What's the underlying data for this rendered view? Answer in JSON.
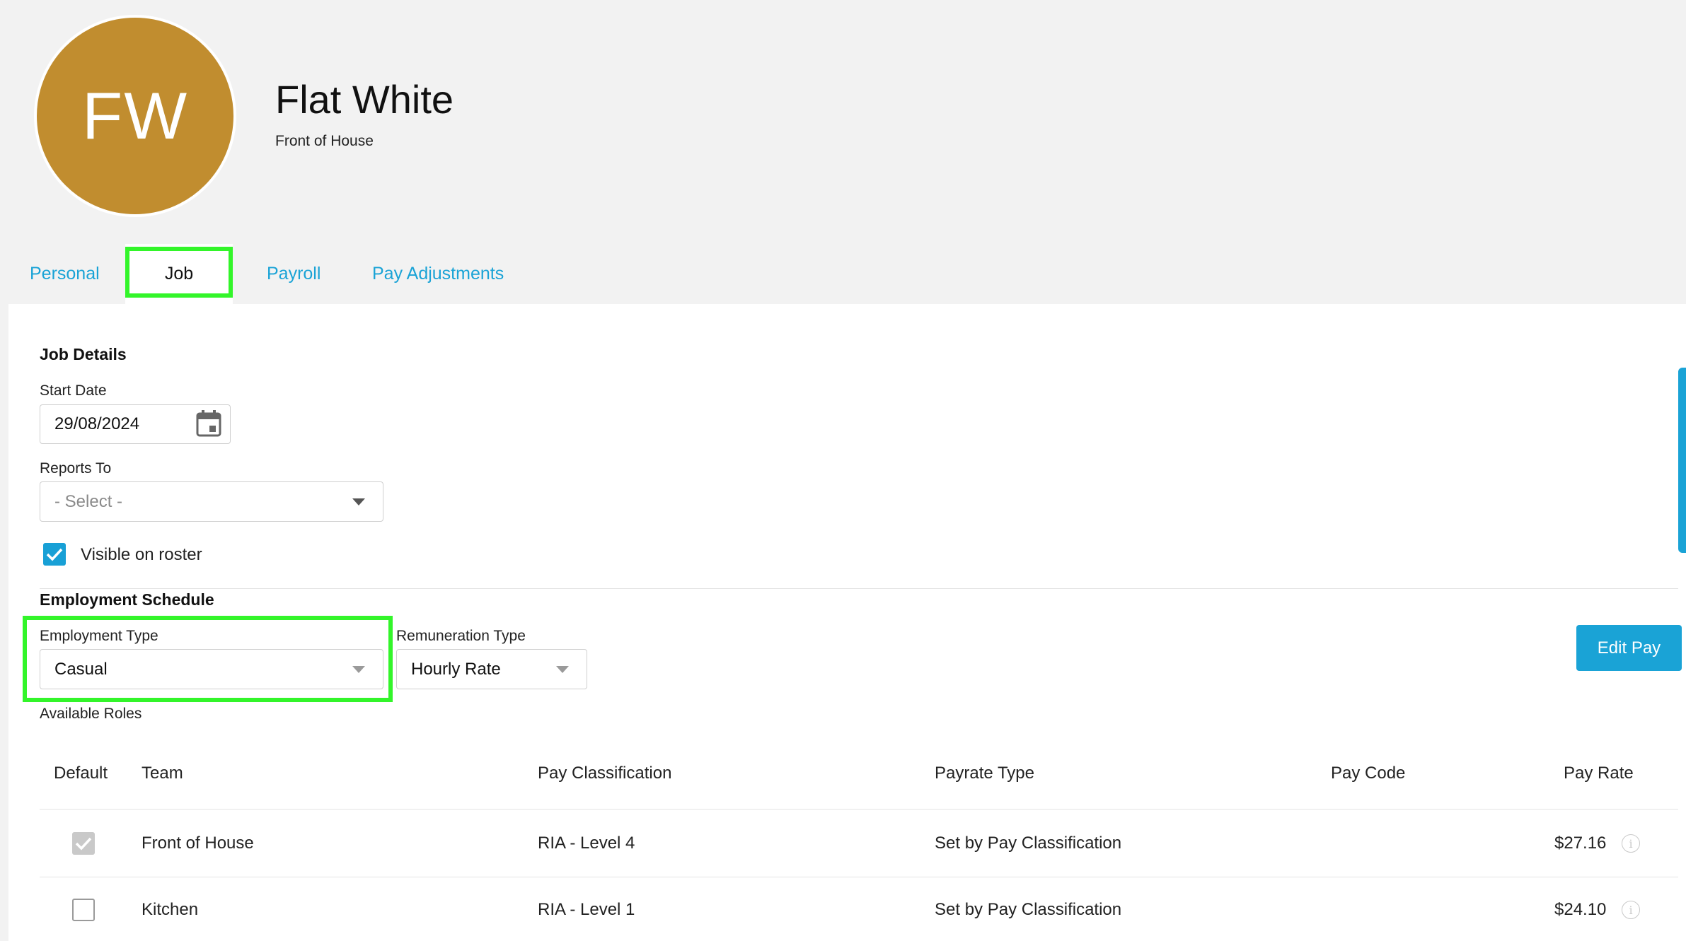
{
  "profile": {
    "initials": "FW",
    "name": "Flat White",
    "team": "Front of House",
    "avatar_color": "#c18d2f"
  },
  "tabs": [
    {
      "label": "Personal",
      "active": false
    },
    {
      "label": "Job",
      "active": true
    },
    {
      "label": "Payroll",
      "active": false
    },
    {
      "label": "Pay Adjustments",
      "active": false
    }
  ],
  "job_details": {
    "title": "Job Details",
    "start_date_label": "Start Date",
    "start_date_value": "29/08/2024",
    "calendar_icon": "calendar-icon",
    "reports_to_label": "Reports To",
    "reports_to_value": "- Select -",
    "visible_on_roster_label": "Visible on roster",
    "visible_on_roster_checked": true
  },
  "employment_schedule": {
    "title": "Employment Schedule",
    "employment_type_label": "Employment Type",
    "employment_type_value": "Casual",
    "remuneration_type_label": "Remuneration Type",
    "remuneration_type_value": "Hourly Rate",
    "edit_pay_label": "Edit Pay",
    "available_roles_label": "Available Roles"
  },
  "roles_table": {
    "headers": [
      "Default",
      "Team",
      "Pay Classification",
      "Payrate Type",
      "Pay Code",
      "Pay Rate"
    ],
    "rows": [
      {
        "default": true,
        "team": "Front of House",
        "pay_classification": "RIA - Level 4",
        "payrate_type": "Set by Pay Classification",
        "pay_code": "",
        "pay_rate": "$27.16"
      },
      {
        "default": false,
        "team": "Kitchen",
        "pay_classification": "RIA - Level 1",
        "payrate_type": "Set by Pay Classification",
        "pay_code": "",
        "pay_rate": "$24.10"
      }
    ]
  },
  "colors": {
    "accent": "#1aa3d6",
    "highlight": "#33f52a"
  }
}
